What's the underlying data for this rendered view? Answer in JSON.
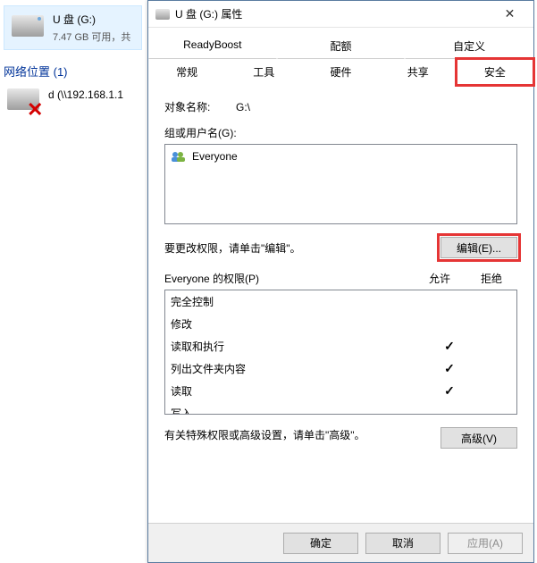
{
  "explorer": {
    "drive": {
      "name": "U 盘 (G:)",
      "sub": "7.47 GB 可用，共"
    },
    "net_header": "网络位置 (1)",
    "net_item": {
      "name": "d (\\\\192.168.1.1"
    }
  },
  "dialog": {
    "title": "U 盘 (G:) 属性",
    "tabs_row1": [
      "ReadyBoost",
      "配额",
      "自定义"
    ],
    "tabs_row2": [
      "常规",
      "工具",
      "硬件",
      "共享",
      "安全"
    ],
    "active_tab": "安全",
    "object_label": "对象名称:",
    "object_value": "G:\\",
    "groups_label": "组或用户名(G):",
    "groups": [
      {
        "name": "Everyone"
      }
    ],
    "edit_hint": "要更改权限，请单击\"编辑\"。",
    "edit_button": "编辑(E)...",
    "perm_header_label": "Everyone 的权限(P)",
    "perm_cols": {
      "allow": "允许",
      "deny": "拒绝"
    },
    "permissions": [
      {
        "name": "完全控制",
        "allow": false,
        "deny": false
      },
      {
        "name": "修改",
        "allow": false,
        "deny": false
      },
      {
        "name": "读取和执行",
        "allow": true,
        "deny": false
      },
      {
        "name": "列出文件夹内容",
        "allow": true,
        "deny": false
      },
      {
        "name": "读取",
        "allow": true,
        "deny": false
      },
      {
        "name": "写入",
        "allow": false,
        "deny": false
      }
    ],
    "adv_hint": "有关特殊权限或高级设置，请单击\"高级\"。",
    "adv_button": "高级(V)",
    "footer": {
      "ok": "确定",
      "cancel": "取消",
      "apply": "应用(A)"
    }
  }
}
